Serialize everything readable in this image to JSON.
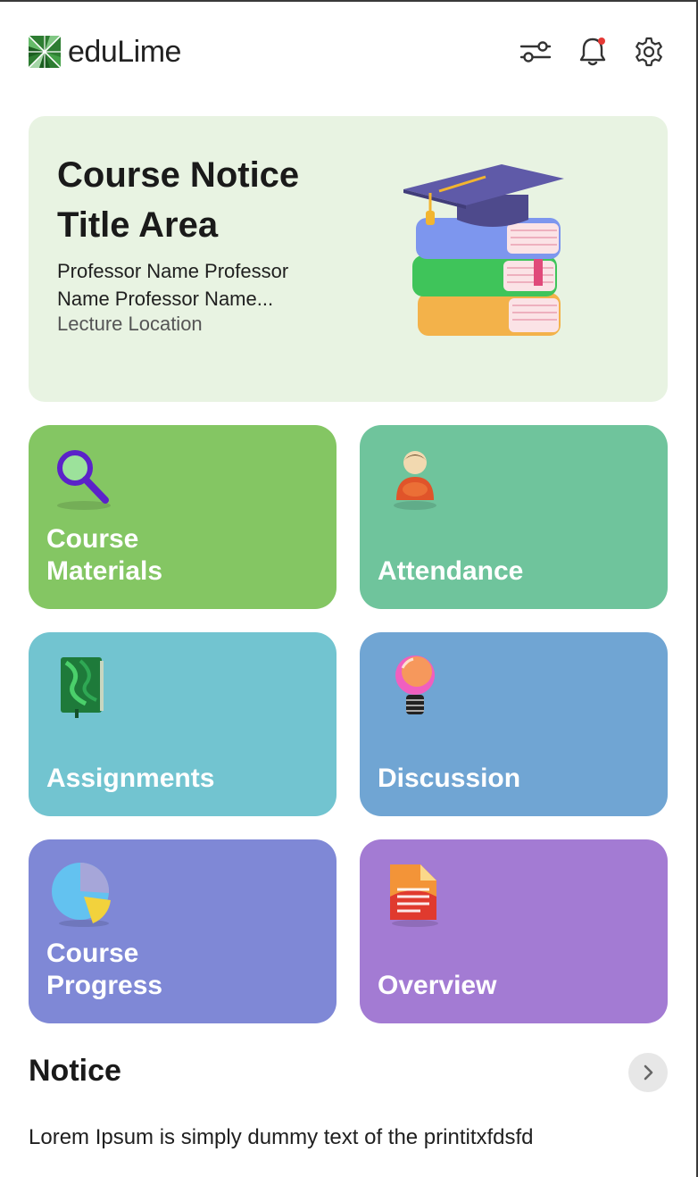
{
  "header": {
    "brand": "eduLime",
    "icons": [
      "logo-icon",
      "filter-icon",
      "bell-icon",
      "gear-icon"
    ],
    "has_notification": true
  },
  "notice_card": {
    "title": "Course Notice Title Area",
    "professor": "Professor Name Professor Name Professor Name...",
    "location": "Lecture Location",
    "background": "#e8f3e2"
  },
  "tiles": [
    {
      "label": "Course Materials",
      "icon": "magnifier-icon",
      "color": "#84c663"
    },
    {
      "label": "Attendance",
      "icon": "person-icon",
      "color": "#6fc49c"
    },
    {
      "label": "Assignments",
      "icon": "notebook-icon",
      "color": "#72c4d0"
    },
    {
      "label": "Discussion",
      "icon": "lightbulb-icon",
      "color": "#70a5d3"
    },
    {
      "label": "Course Progress",
      "icon": "pie-chart-icon",
      "color": "#7f88d6"
    },
    {
      "label": "Overview",
      "icon": "document-icon",
      "color": "#a37bd3"
    }
  ],
  "notice_section": {
    "heading": "Notice",
    "preview": "Lorem Ipsum is simply dummy text of the printitxfdsfd"
  }
}
